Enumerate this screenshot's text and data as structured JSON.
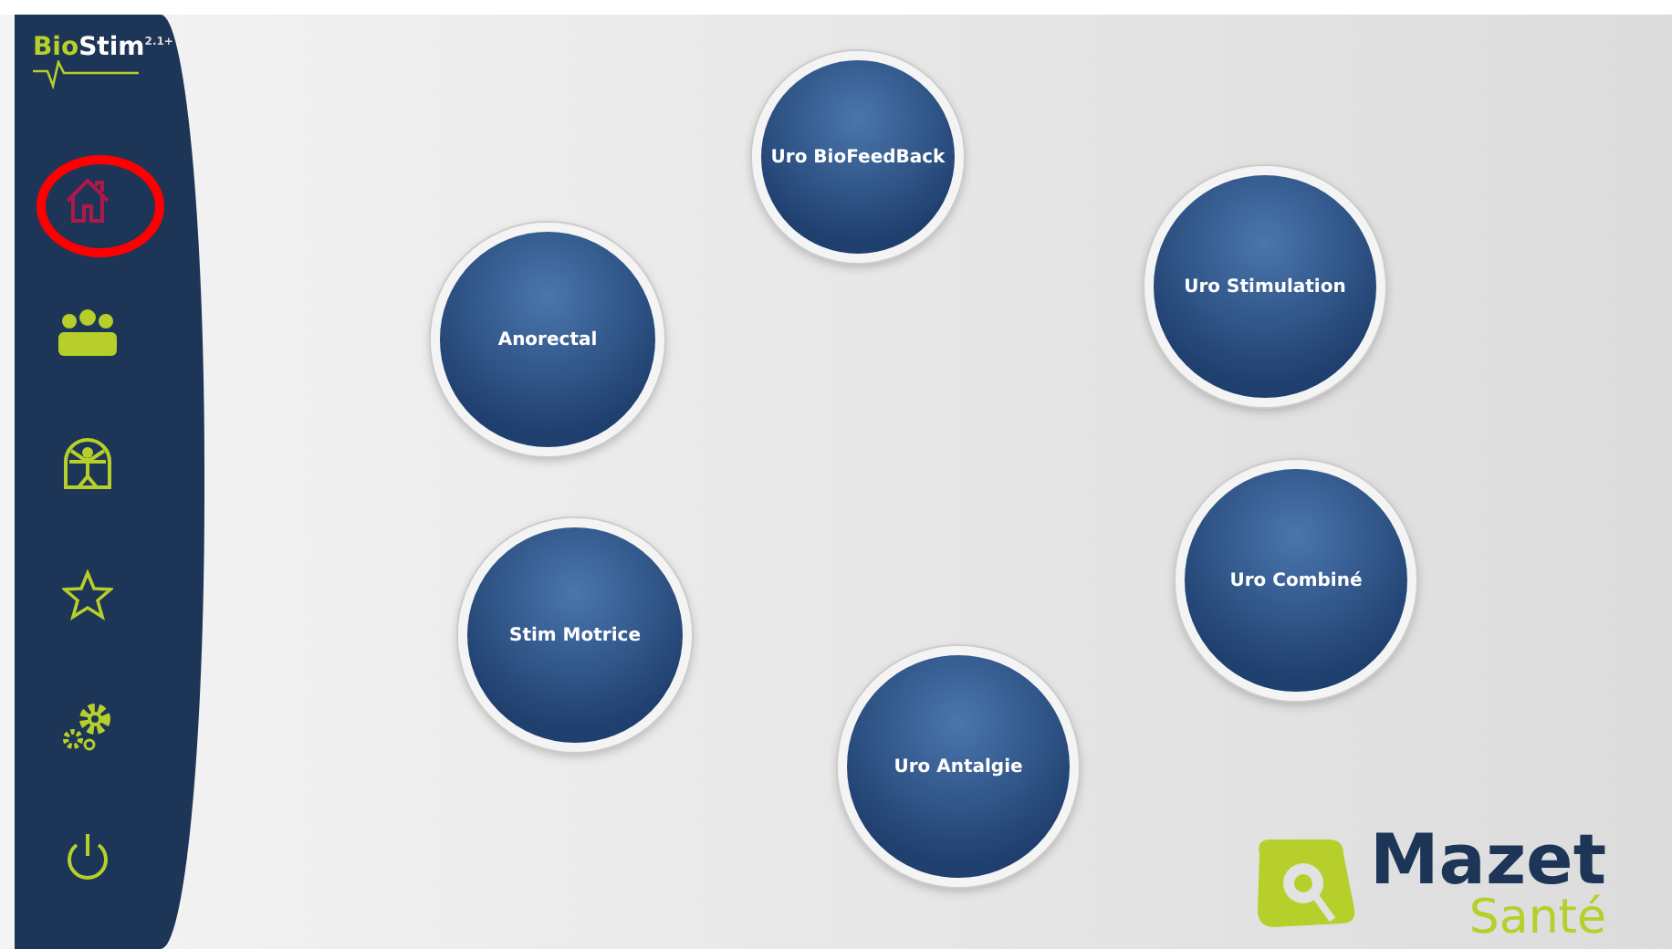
{
  "sidebar": {
    "logo": {
      "part1": "Bio",
      "part2": "Stim",
      "version": "2.1+"
    },
    "items": [
      {
        "kind": "home",
        "selected": true,
        "highlighted": true
      },
      {
        "kind": "patients",
        "selected": false,
        "highlighted": false
      },
      {
        "kind": "body",
        "selected": false,
        "highlighted": false
      },
      {
        "kind": "favorites",
        "selected": false,
        "highlighted": false
      },
      {
        "kind": "settings",
        "selected": false,
        "highlighted": false
      },
      {
        "kind": "power",
        "selected": false,
        "highlighted": false
      }
    ]
  },
  "programs": [
    {
      "label": "Uro BioFeedBack"
    },
    {
      "label": "Uro Stimulation"
    },
    {
      "label": "Anorectal"
    },
    {
      "label": "Uro Combiné"
    },
    {
      "label": "Stim Motrice"
    },
    {
      "label": "Uro Antalgie"
    }
  ],
  "brand": {
    "name": "Mazet",
    "subtitle": "Santé"
  }
}
